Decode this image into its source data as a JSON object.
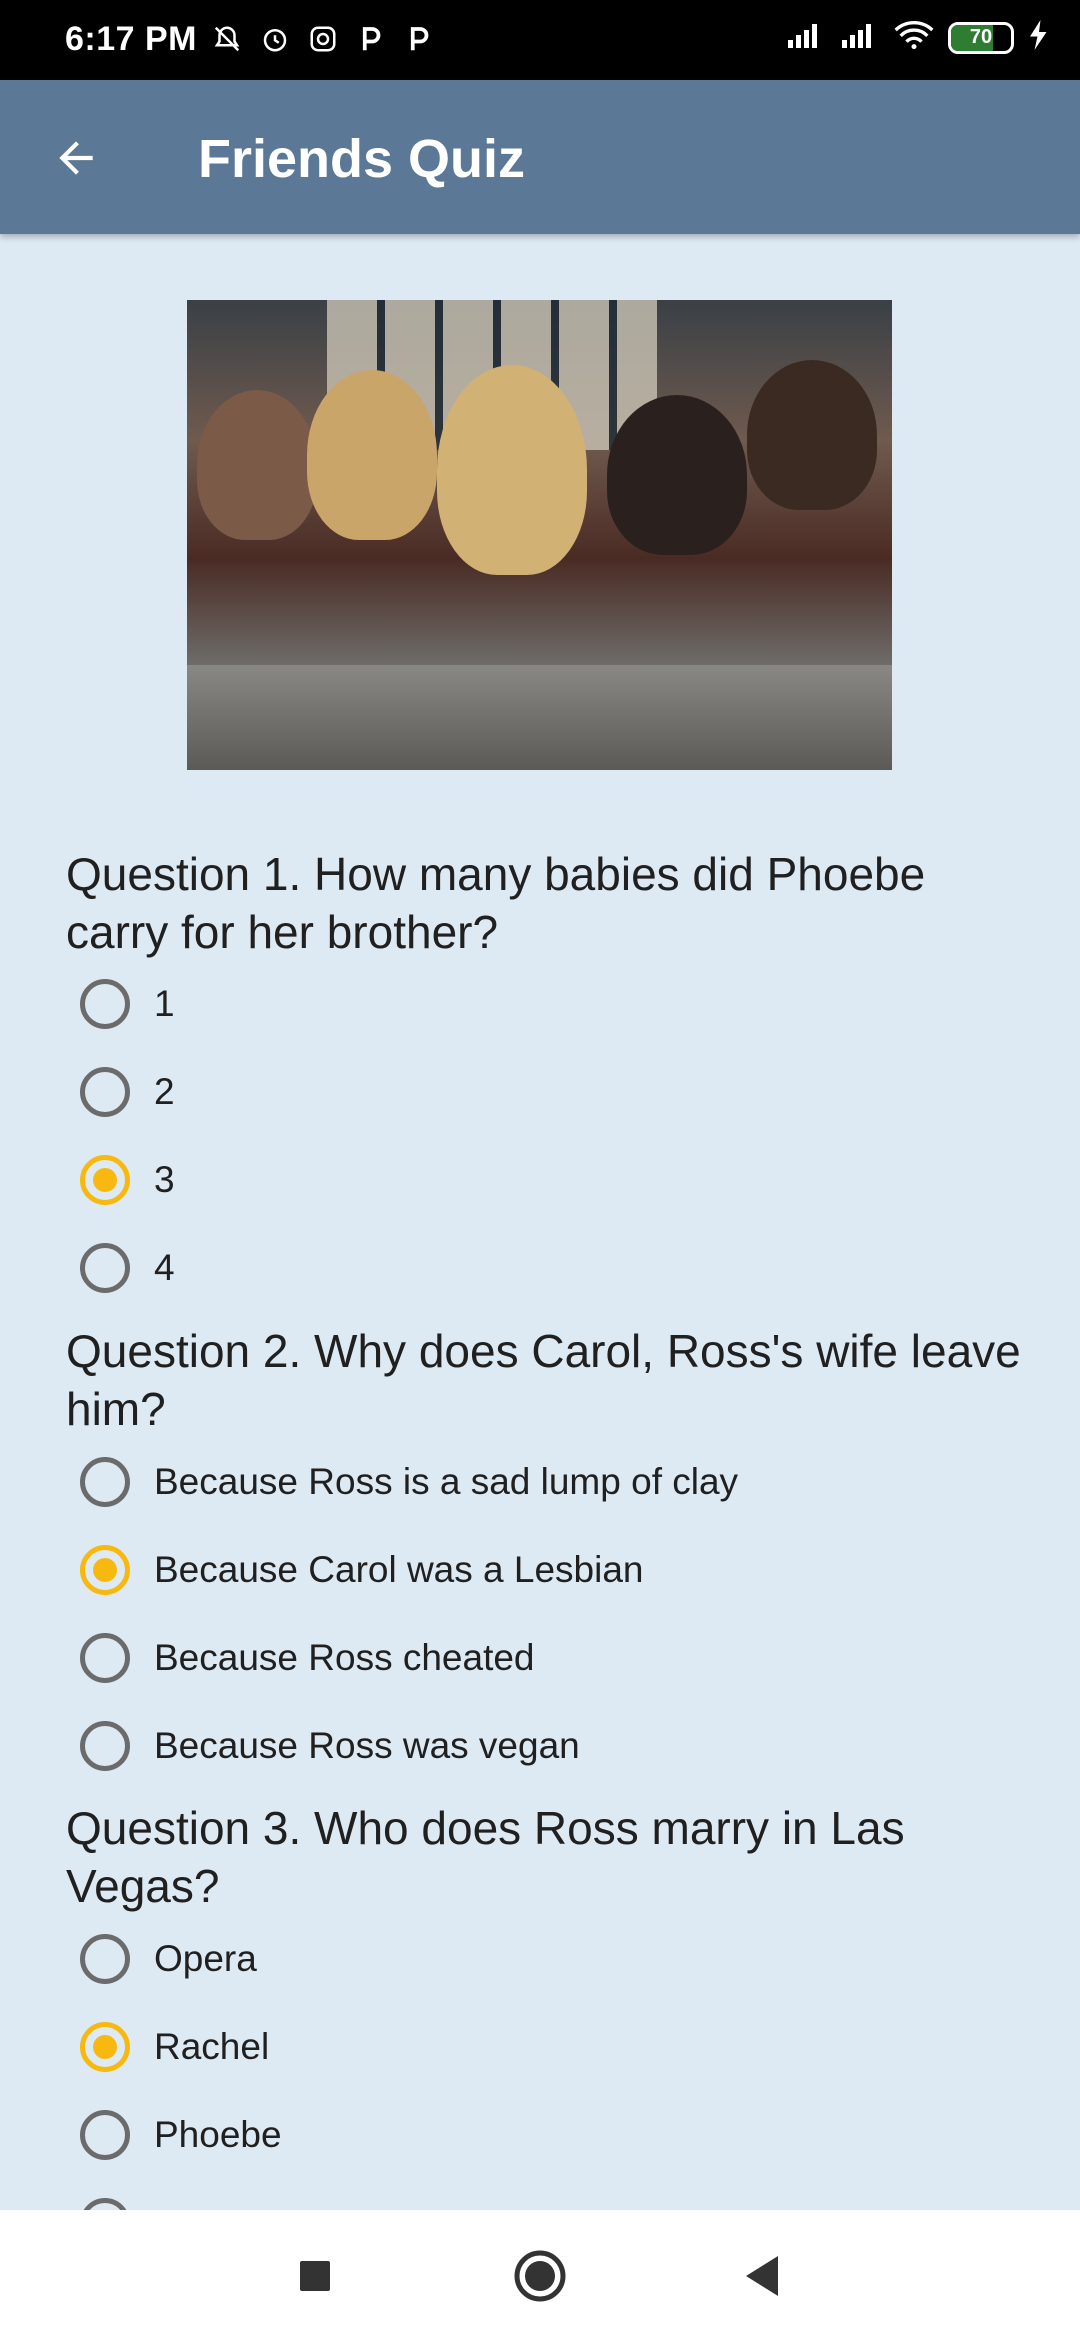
{
  "status": {
    "time": "6:17 PM",
    "battery": "70",
    "battery_level": 0.7
  },
  "appbar": {
    "title": "Friends Quiz"
  },
  "questions": [
    {
      "text": "Question 1. How many babies did Phoebe carry for her brother?",
      "options": [
        "1",
        "2",
        "3",
        "4"
      ],
      "selected": 2
    },
    {
      "text": "Question 2. Why does Carol, Ross's wife leave him?",
      "options": [
        "Because Ross is a sad lump of clay",
        "Because Carol was a Lesbian",
        "Because Ross cheated",
        "Because Ross was vegan"
      ],
      "selected": 1
    },
    {
      "text": "Question 3. Who does Ross marry in Las Vegas?",
      "options": [
        "Opera",
        "Rachel",
        "Phoebe"
      ],
      "selected": 1
    }
  ],
  "colors": {
    "appbar": "#5b7896",
    "background": "#dde9f3",
    "accent": "#f7b90f"
  }
}
